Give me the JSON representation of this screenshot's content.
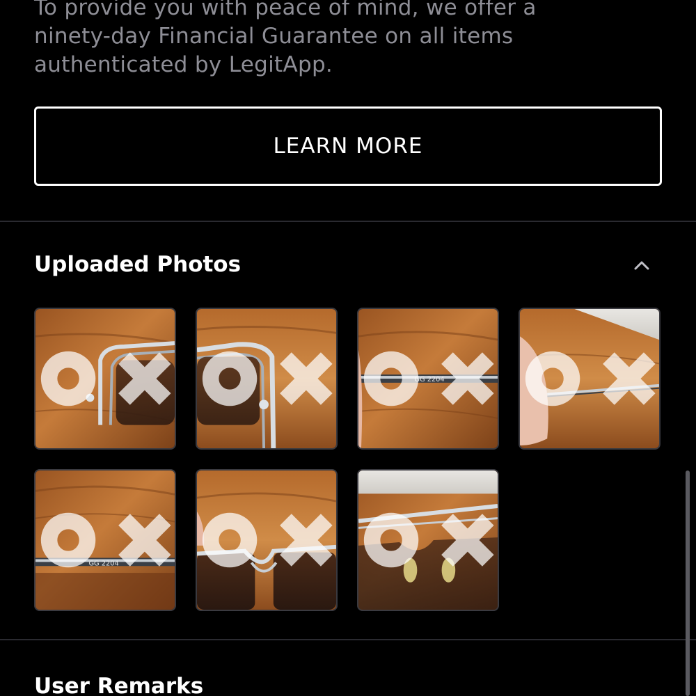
{
  "guarantee": {
    "line1": "To provide you with peace of mind, we offer a",
    "line2": "ninety-day Financial Guarantee on all items",
    "line3": "authenticated by LegitApp."
  },
  "learn_more_label": "LEARN MORE",
  "uploaded_photos": {
    "title": "Uploaded Photos",
    "collapse_icon": "chevron-up-icon",
    "watermark_glyphs": [
      "O",
      "X"
    ],
    "photos": [
      {
        "name": "photo-1",
        "subject": "glasses-frame-top"
      },
      {
        "name": "photo-2",
        "subject": "glasses-frame-hinge"
      },
      {
        "name": "photo-3",
        "subject": "temple-arm-engraving"
      },
      {
        "name": "photo-4",
        "subject": "temple-arm-in-hand"
      },
      {
        "name": "photo-5",
        "subject": "temple-arm-closeup"
      },
      {
        "name": "photo-6",
        "subject": "glasses-bridge"
      },
      {
        "name": "photo-7",
        "subject": "nose-pads"
      }
    ],
    "photo_engravings": {
      "photo3": "GG  2204",
      "photo5": "GG  2204"
    }
  },
  "user_remarks": {
    "title": "User Remarks"
  },
  "colors": {
    "background": "#000000",
    "muted_text": "#8e8e96",
    "divider": "#2a2a30",
    "wood_dark": "#8a4a1c",
    "wood_light": "#c27a38"
  }
}
